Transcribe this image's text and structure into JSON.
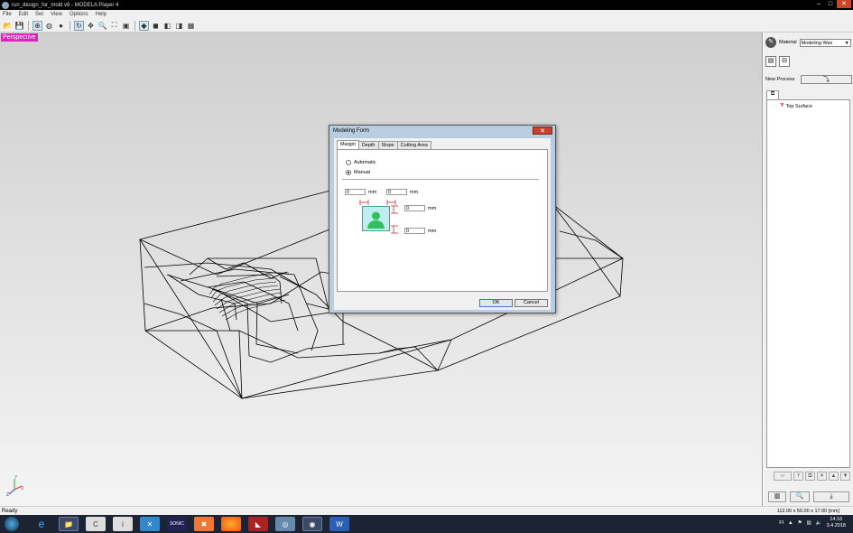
{
  "window": {
    "title": "run_design_for_mold v8 - MODELA Player 4",
    "min": "–",
    "max": "□",
    "close": "✕"
  },
  "menu": [
    "File",
    "Edit",
    "Set",
    "View",
    "Options",
    "Help"
  ],
  "viewport": {
    "label": "Perspective"
  },
  "right_panel": {
    "material_label": "Material",
    "material_value": "Modeling Wax",
    "new_process_label": "New Process",
    "tree_item": "Top Surface"
  },
  "dialog": {
    "title": "Modeling Form",
    "tabs": [
      "Margin",
      "Depth",
      "Slope",
      "Cutting Area"
    ],
    "radio_automatic": "Automatic",
    "radio_manual": "Manual",
    "margin_left": "0",
    "margin_right": "0",
    "margin_top": "0",
    "margin_bottom": "0",
    "unit": "mm",
    "ok": "OK",
    "cancel": "Cancel"
  },
  "status": {
    "text": "Ready",
    "dims": "112.00 x 56.00 x 17.00 [mm]"
  },
  "taskbar": {
    "lang": "FI",
    "time": "14:16",
    "date": "3.4.2018"
  },
  "colors": {
    "persp_tag": "#e020c0",
    "taskbar": "#1c2433",
    "dialog_frame": "#b8cde0"
  }
}
